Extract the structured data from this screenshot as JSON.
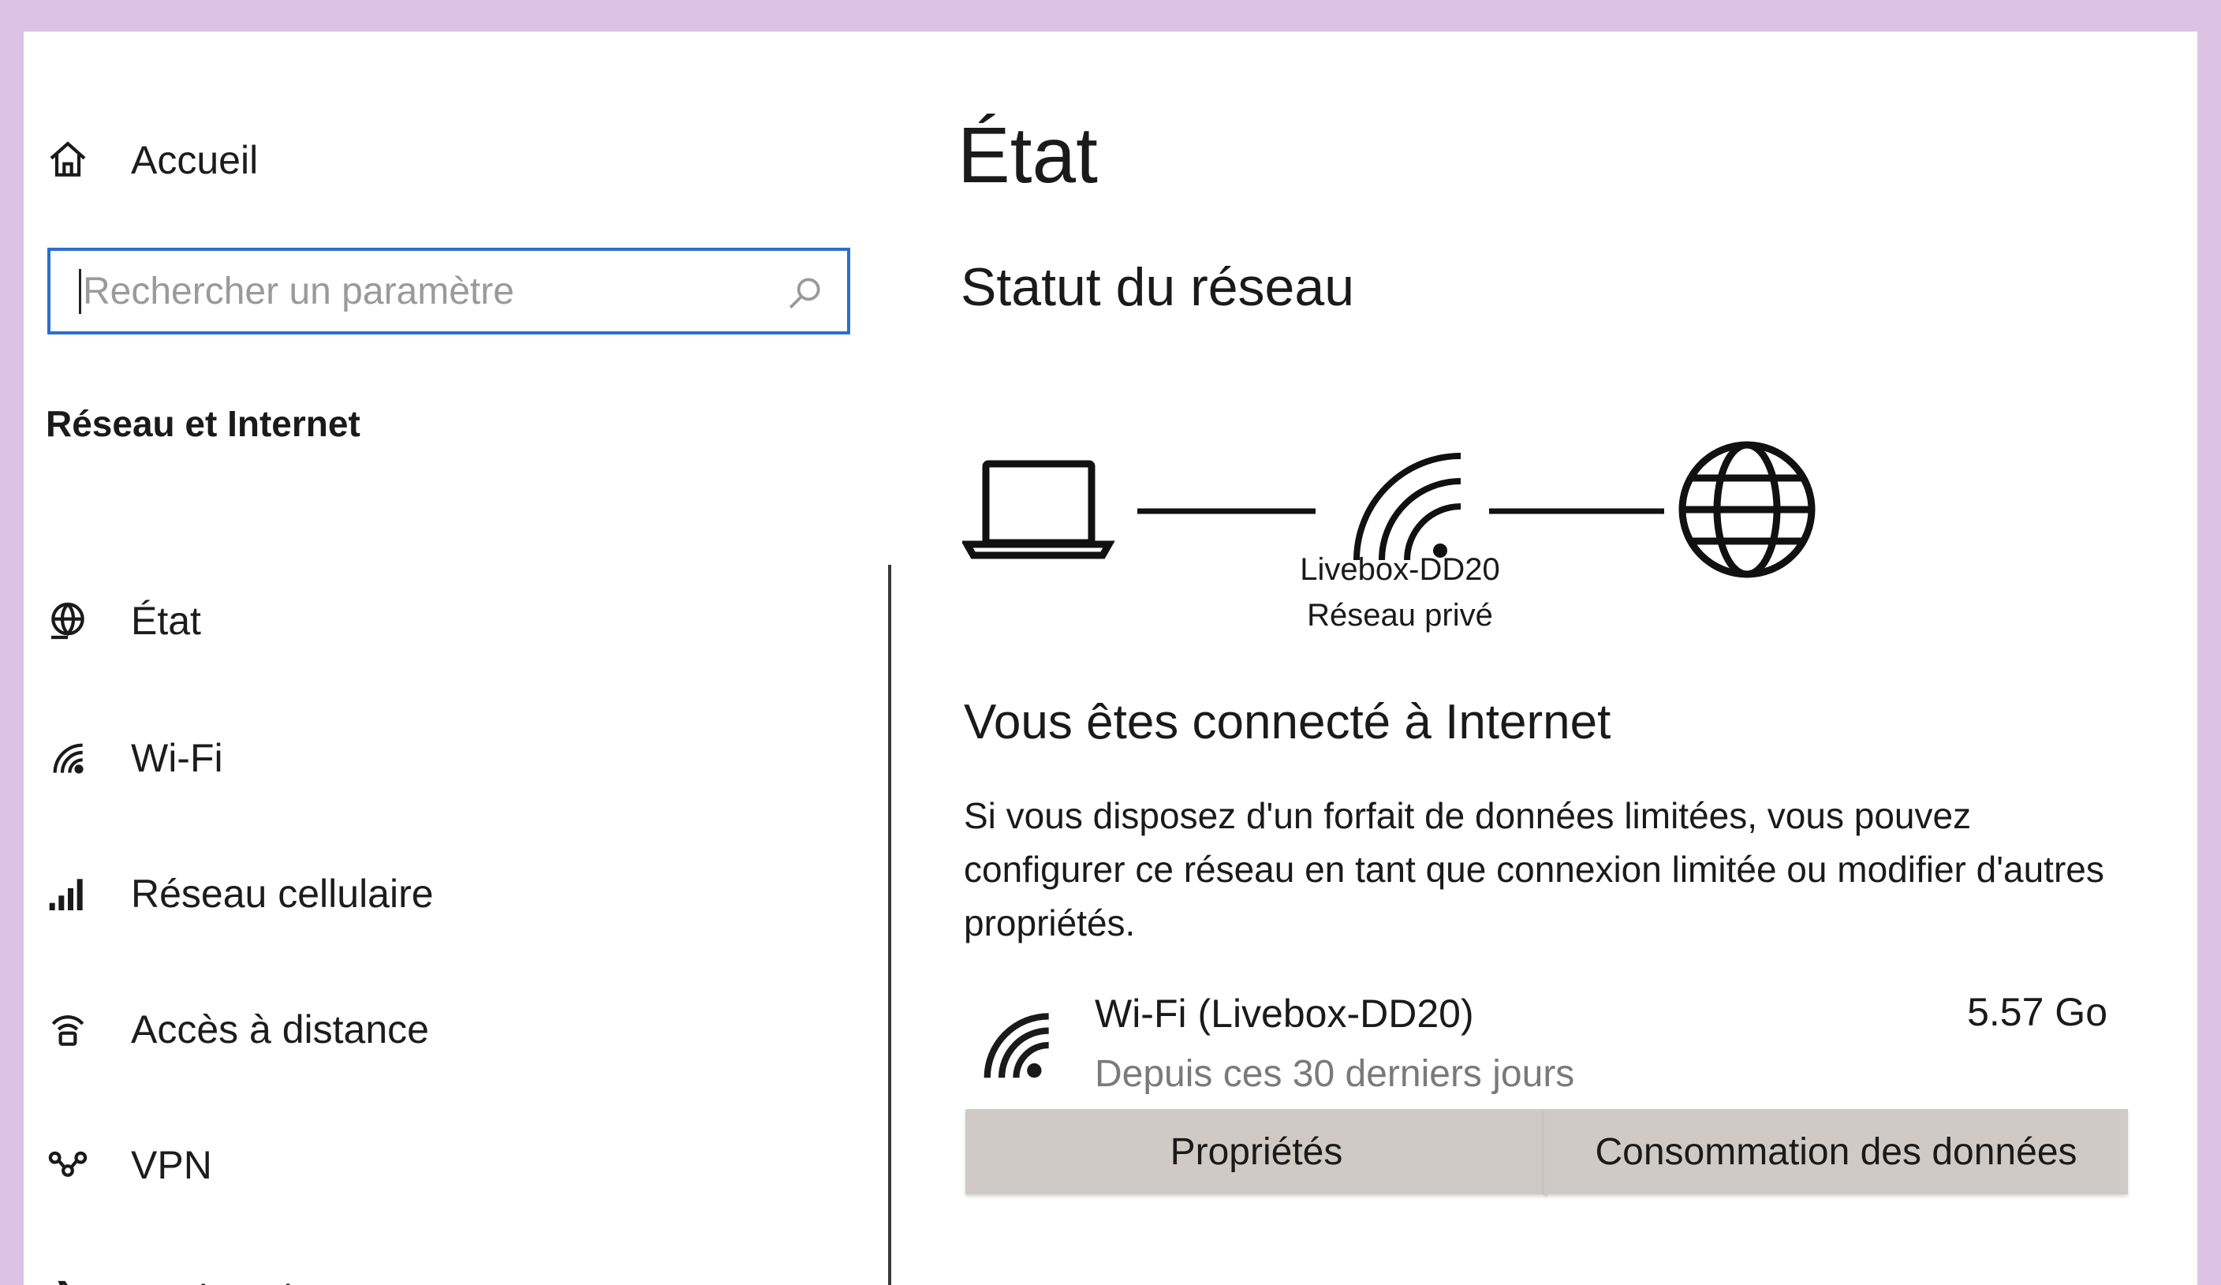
{
  "sidebar": {
    "home_label": "Accueil",
    "search_placeholder": "Rechercher un paramètre",
    "section_title": "Réseau et Internet",
    "items": [
      {
        "label": "État",
        "icon": "globe-status-icon"
      },
      {
        "label": "Wi-Fi",
        "icon": "wifi-icon"
      },
      {
        "label": "Réseau cellulaire",
        "icon": "cellular-icon"
      },
      {
        "label": "Accès à distance",
        "icon": "dialup-icon"
      },
      {
        "label": "VPN",
        "icon": "vpn-icon"
      },
      {
        "label": "Mode Avion",
        "icon": "airplane-icon"
      }
    ]
  },
  "main": {
    "title": "État",
    "subheading": "Statut du réseau",
    "network": {
      "name": "Livebox-DD20",
      "type": "Réseau privé"
    },
    "connected_title": "Vous êtes connecté à Internet",
    "description": "Si vous disposez d'un forfait de données limitées, vous pouvez configurer ce réseau en tant que connexion limitée ou modifier d'autres propriétés.",
    "connection": {
      "name": "Wi-Fi (Livebox-DD20)",
      "period": "Depuis ces 30 derniers jours",
      "usage": "5.57 Go"
    },
    "buttons": {
      "properties": "Propriétés",
      "data_usage": "Consommation des données"
    }
  },
  "colors": {
    "background": "#dcc3e6",
    "search_border": "#2b6fd0",
    "button_bg": "#cfcac6"
  }
}
